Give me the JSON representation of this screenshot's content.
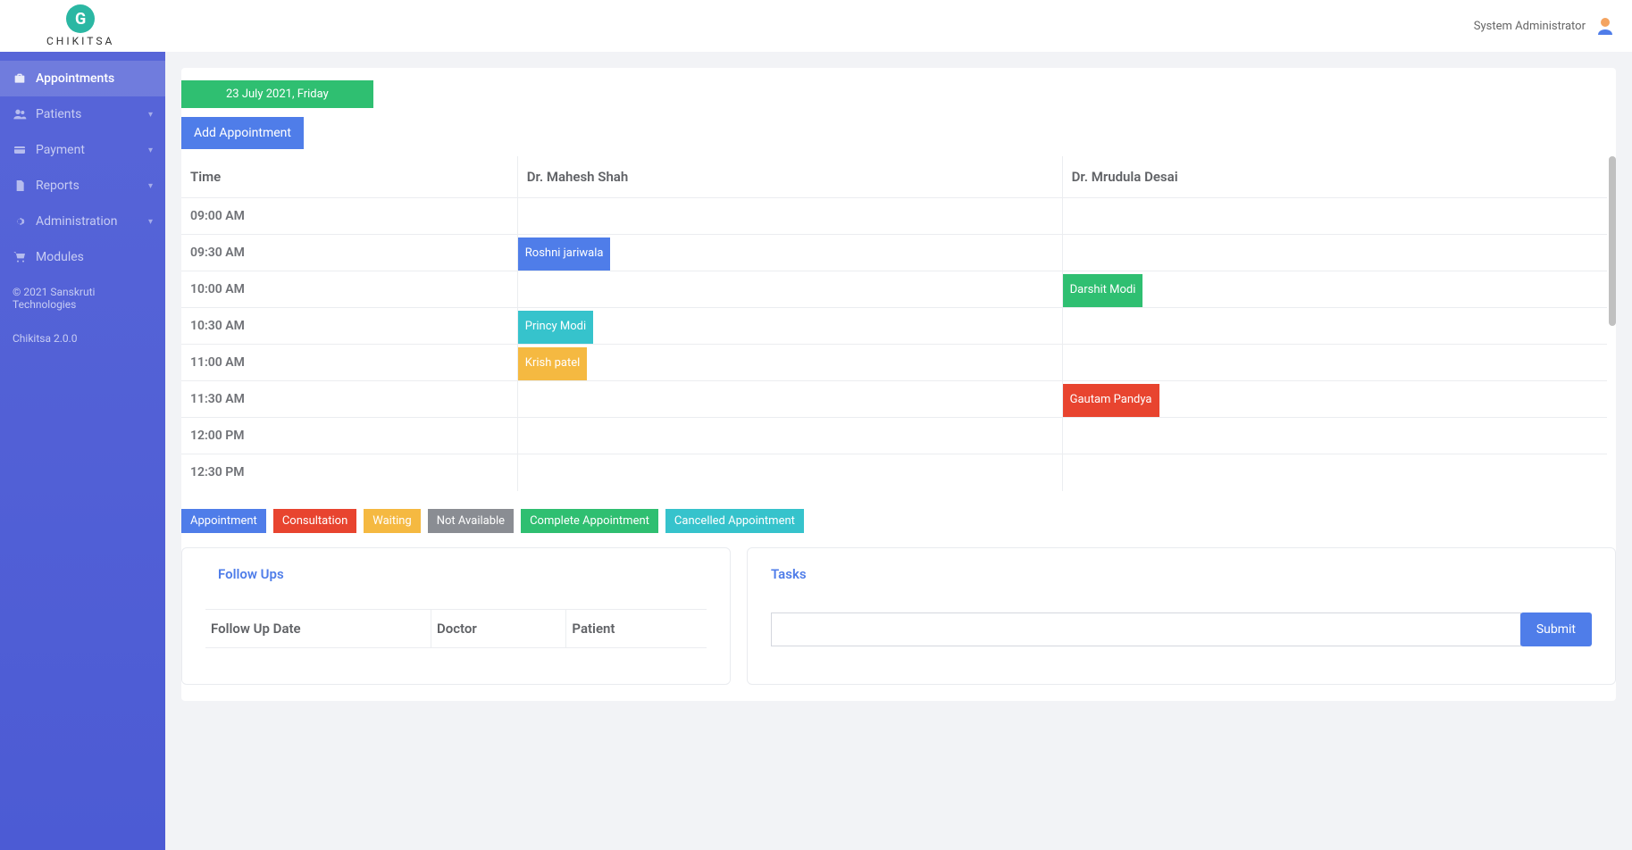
{
  "brand": {
    "name": "CHIKITSA",
    "glyph": "G"
  },
  "header": {
    "user_name": "System Administrator"
  },
  "sidebar": {
    "items": [
      {
        "label": "Appointments",
        "icon": "briefcase",
        "active": true,
        "expandable": false
      },
      {
        "label": "Patients",
        "icon": "users",
        "active": false,
        "expandable": true
      },
      {
        "label": "Payment",
        "icon": "card",
        "active": false,
        "expandable": true
      },
      {
        "label": "Reports",
        "icon": "file",
        "active": false,
        "expandable": true
      },
      {
        "label": "Administration",
        "icon": "gear",
        "active": false,
        "expandable": true
      },
      {
        "label": "Modules",
        "icon": "cart",
        "active": false,
        "expandable": false
      }
    ],
    "copyright": "© 2021 Sanskruti Technologies",
    "version": "Chikitsa 2.0.0"
  },
  "appointments": {
    "date_label": "23 July 2021, Friday",
    "add_button": "Add Appointment",
    "columns": {
      "time": "Time",
      "doctor1": "Dr. Mahesh Shah",
      "doctor2": "Dr. Mrudula Desai"
    },
    "rows": [
      {
        "time": "09:00 AM",
        "d1": null,
        "d2": null
      },
      {
        "time": "09:30 AM",
        "d1": {
          "patient": "Roshni jariwala",
          "status": "blue"
        },
        "d2": null
      },
      {
        "time": "10:00 AM",
        "d1": null,
        "d2": {
          "patient": "Darshit Modi",
          "status": "green"
        }
      },
      {
        "time": "10:30 AM",
        "d1": {
          "patient": "Princy Modi",
          "status": "teal"
        },
        "d2": null
      },
      {
        "time": "11:00 AM",
        "d1": {
          "patient": "Krish patel",
          "status": "amber"
        },
        "d2": null
      },
      {
        "time": "11:30 AM",
        "d1": null,
        "d2": {
          "patient": "Gautam Pandya",
          "status": "red"
        }
      },
      {
        "time": "12:00 PM",
        "d1": null,
        "d2": null
      },
      {
        "time": "12:30 PM",
        "d1": null,
        "d2": null
      }
    ]
  },
  "legend": [
    {
      "label": "Appointment",
      "color": "blue"
    },
    {
      "label": "Consultation",
      "color": "red"
    },
    {
      "label": "Waiting",
      "color": "amber"
    },
    {
      "label": "Not Available",
      "color": "gray"
    },
    {
      "label": "Complete Appointment",
      "color": "green"
    },
    {
      "label": "Cancelled Appointment",
      "color": "teal"
    }
  ],
  "followups": {
    "title": "Follow Ups",
    "columns": {
      "date": "Follow Up Date",
      "doctor": "Doctor",
      "patient": "Patient"
    }
  },
  "tasks": {
    "title": "Tasks",
    "input_value": "",
    "submit_label": "Submit"
  }
}
